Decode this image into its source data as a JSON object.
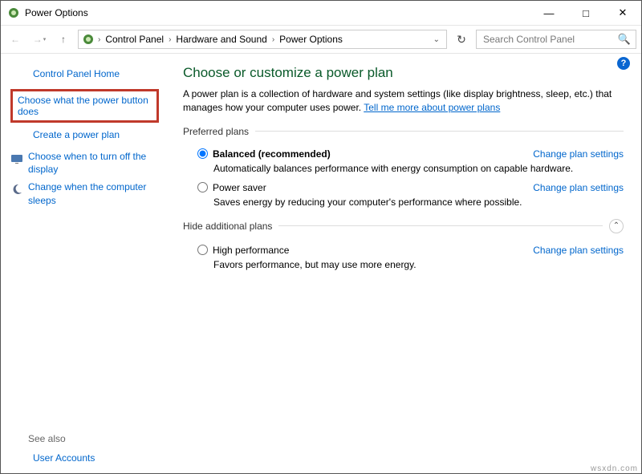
{
  "title": "Power Options",
  "breadcrumbs": [
    "Control Panel",
    "Hardware and Sound",
    "Power Options"
  ],
  "search": {
    "placeholder": "Search Control Panel"
  },
  "sidebar": {
    "home": "Control Panel Home",
    "items": [
      "Choose what the power button does",
      "Create a power plan",
      "Choose when to turn off the display",
      "Change when the computer sleeps"
    ],
    "seealso_label": "See also",
    "seealso": [
      "User Accounts"
    ]
  },
  "main": {
    "heading": "Choose or customize a power plan",
    "description": "A power plan is a collection of hardware and system settings (like display brightness, sleep, etc.) that manages how your computer uses power. ",
    "learn_link": "Tell me more about power plans",
    "preferred_label": "Preferred plans",
    "hidden_label": "Hide additional plans",
    "change_link": "Change plan settings",
    "plans": {
      "balanced": {
        "name": "Balanced (recommended)",
        "desc": "Automatically balances performance with energy consumption on capable hardware."
      },
      "saver": {
        "name": "Power saver",
        "desc": "Saves energy by reducing your computer's performance where possible."
      },
      "high": {
        "name": "High performance",
        "desc": "Favors performance, but may use more energy."
      }
    }
  },
  "watermark": "wsxdn.com"
}
